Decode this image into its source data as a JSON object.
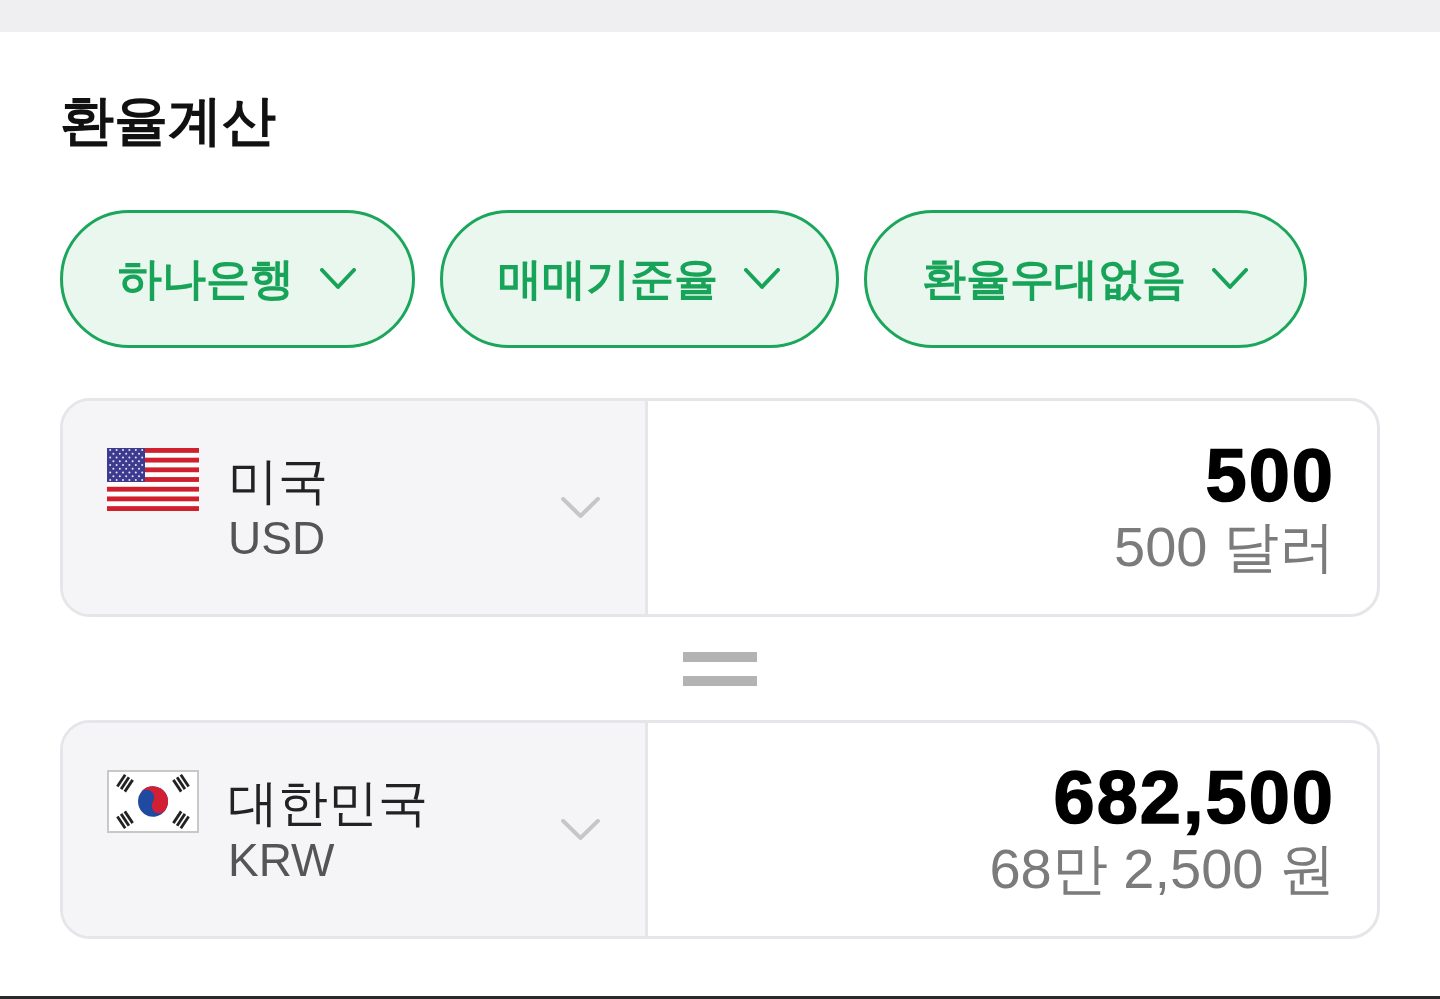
{
  "title": "환율계산",
  "filters": [
    {
      "label": "하나은행"
    },
    {
      "label": "매매기준율"
    },
    {
      "label": "환율우대없음"
    }
  ],
  "currencies": [
    {
      "country": "미국",
      "code": "USD",
      "amount": "500",
      "amount_words": "500 달러"
    },
    {
      "country": "대한민국",
      "code": "KRW",
      "amount": "682,500",
      "amount_words": "68만 2,500 원"
    }
  ]
}
